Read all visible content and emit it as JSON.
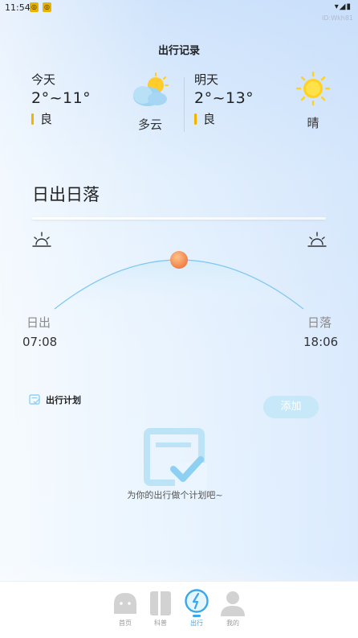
{
  "status": {
    "time": "11:54",
    "badges": [
      "◎",
      "◎"
    ],
    "icons": "▾◢▮",
    "sub": "ID:Wkh81"
  },
  "page": {
    "title": "出行记录"
  },
  "today": {
    "label": "今天",
    "temp": "2°~11°",
    "air": "良",
    "weather": "多云",
    "weather_icon": "cloudy-sun-icon"
  },
  "tomorrow": {
    "label": "明天",
    "temp": "2°~13°",
    "air": "良",
    "weather": "晴",
    "weather_icon": "sun-icon"
  },
  "sun": {
    "section_title": "日出日落",
    "sunrise_label": "日出",
    "sunrise_time": "07:08",
    "sunset_label": "日落",
    "sunset_time": "18:06"
  },
  "plan": {
    "title": "出行计划",
    "add_label": "添加",
    "empty_text": "为你的出行做个计划吧~"
  },
  "tabbar": {
    "items": [
      {
        "label": "首页",
        "icon": "home-icon",
        "active": false
      },
      {
        "label": "科普",
        "icon": "book-icon",
        "active": false
      },
      {
        "label": "出行",
        "icon": "travel-icon",
        "active": true
      },
      {
        "label": "我的",
        "icon": "user-icon",
        "active": false
      }
    ]
  },
  "colors": {
    "accent": "#3aa7ea",
    "air_bar": "#f3b400",
    "add_button": "#c6e8f8",
    "sun_dot": "#f07b45"
  }
}
